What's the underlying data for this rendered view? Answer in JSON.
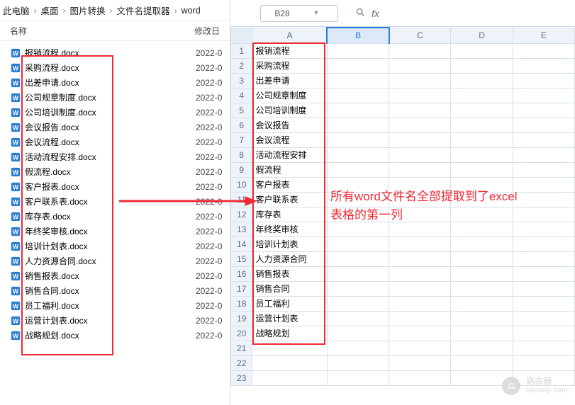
{
  "breadcrumb": {
    "items": [
      "此电脑",
      "桌面",
      "图片转换",
      "文件名提取器",
      "word"
    ]
  },
  "explorer": {
    "col_name": "名称",
    "col_date": "修改日",
    "files": [
      {
        "name": "报销流程.docx",
        "date": "2022-0"
      },
      {
        "name": "采购流程.docx",
        "date": "2022-0"
      },
      {
        "name": "出差申请.docx",
        "date": "2022-0"
      },
      {
        "name": "公司规章制度.docx",
        "date": "2022-0"
      },
      {
        "name": "公司培训制度.docx",
        "date": "2022-0"
      },
      {
        "name": "会议报告.docx",
        "date": "2022-0"
      },
      {
        "name": "会议流程.docx",
        "date": "2022-0"
      },
      {
        "name": "活动流程安排.docx",
        "date": "2022-0"
      },
      {
        "name": "假流程.docx",
        "date": "2022-0"
      },
      {
        "name": "客户报表.docx",
        "date": "2022-0"
      },
      {
        "name": "客户联系表.docx",
        "date": "2022-0"
      },
      {
        "name": "库存表.docx",
        "date": "2022-0"
      },
      {
        "name": "年终奖审核.docx",
        "date": "2022-0"
      },
      {
        "name": "培训计划表.docx",
        "date": "2022-0"
      },
      {
        "name": "人力资源合同.docx",
        "date": "2022-0"
      },
      {
        "name": "销售报表.docx",
        "date": "2022-0"
      },
      {
        "name": "销售合同.docx",
        "date": "2022-0"
      },
      {
        "name": "员工福利.docx",
        "date": "2022-0"
      },
      {
        "name": "运营计划表.docx",
        "date": "2022-0"
      },
      {
        "name": "战略规划.docx",
        "date": "2022-0"
      }
    ]
  },
  "sheet": {
    "cell_reference": "B28",
    "fx_symbol": "fx",
    "columns": [
      "A",
      "B",
      "C",
      "D",
      "E"
    ],
    "rows": [
      {
        "n": "1",
        "A": "报销流程"
      },
      {
        "n": "2",
        "A": "采购流程"
      },
      {
        "n": "3",
        "A": "出差申请"
      },
      {
        "n": "4",
        "A": "公司规章制度"
      },
      {
        "n": "5",
        "A": "公司培训制度"
      },
      {
        "n": "6",
        "A": "会议报告"
      },
      {
        "n": "7",
        "A": "会议流程"
      },
      {
        "n": "8",
        "A": "活动流程安排"
      },
      {
        "n": "9",
        "A": "假流程"
      },
      {
        "n": "10",
        "A": "客户报表"
      },
      {
        "n": "11",
        "A": "客户联系表"
      },
      {
        "n": "12",
        "A": "库存表"
      },
      {
        "n": "13",
        "A": "年终奖审核"
      },
      {
        "n": "14",
        "A": "培训计划表"
      },
      {
        "n": "15",
        "A": "人力资源合同"
      },
      {
        "n": "16",
        "A": "销售报表"
      },
      {
        "n": "17",
        "A": "销售合同"
      },
      {
        "n": "18",
        "A": "员工福利"
      },
      {
        "n": "19",
        "A": "运营计划表"
      },
      {
        "n": "20",
        "A": "战略规划"
      },
      {
        "n": "21",
        "A": ""
      },
      {
        "n": "22",
        "A": ""
      },
      {
        "n": "23",
        "A": ""
      }
    ]
  },
  "annotation": {
    "line1": "所有word文件名全部提取到了excel",
    "line2": "表格的第一列"
  },
  "watermark": {
    "text1": "路由器",
    "text2": "luyouqi.com"
  }
}
